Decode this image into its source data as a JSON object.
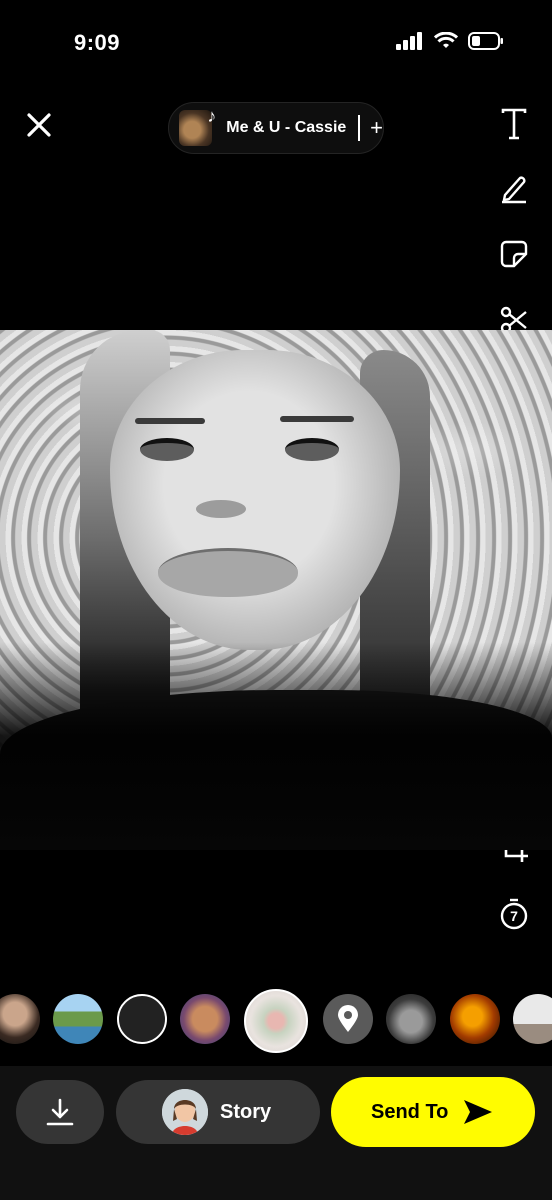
{
  "status_bar": {
    "time": "9:09"
  },
  "header": {
    "close_icon": "close-icon",
    "music": {
      "label": "Me & U - Cassie",
      "add_label": "+"
    }
  },
  "tools": [
    {
      "name": "text-tool",
      "icon": "text-T-icon"
    },
    {
      "name": "draw-tool",
      "icon": "pencil-icon"
    },
    {
      "name": "sticker-tool",
      "icon": "sticker-icon"
    },
    {
      "name": "scissors-tool",
      "icon": "scissors-icon"
    },
    {
      "name": "music-tool",
      "icon": "music-note-icon"
    },
    {
      "name": "scan-tool",
      "icon": "scan-face-icon"
    },
    {
      "name": "search-sparkle-tool",
      "icon": "search-sparkle-icon"
    },
    {
      "name": "ai-sparkle-tool",
      "icon": "sparkle-icon"
    },
    {
      "name": "magic-wand-tool",
      "icon": "magic-wand-icon"
    },
    {
      "name": "eraser-tool",
      "icon": "eraser-icon"
    },
    {
      "name": "attach-tool",
      "icon": "paperclip-icon"
    },
    {
      "name": "crop-tool",
      "icon": "crop-icon"
    },
    {
      "name": "timer-tool",
      "icon": "timer-icon",
      "value": "7"
    }
  ],
  "lenses": [
    {
      "name": "lens-portrait"
    },
    {
      "name": "lens-landscape"
    },
    {
      "name": "lens-outline"
    },
    {
      "name": "lens-face-effect"
    },
    {
      "name": "lens-selected-flowers"
    },
    {
      "name": "lens-location",
      "icon": "location-pin-icon"
    },
    {
      "name": "lens-person"
    },
    {
      "name": "lens-sunset"
    },
    {
      "name": "lens-gallery"
    }
  ],
  "bottom_bar": {
    "download_icon": "download-icon",
    "story_label": "Story",
    "send_label": "Send To",
    "send_icon": "send-arrow-icon"
  },
  "colors": {
    "send_button": "#fffc00",
    "pill_bg": "#353535"
  }
}
